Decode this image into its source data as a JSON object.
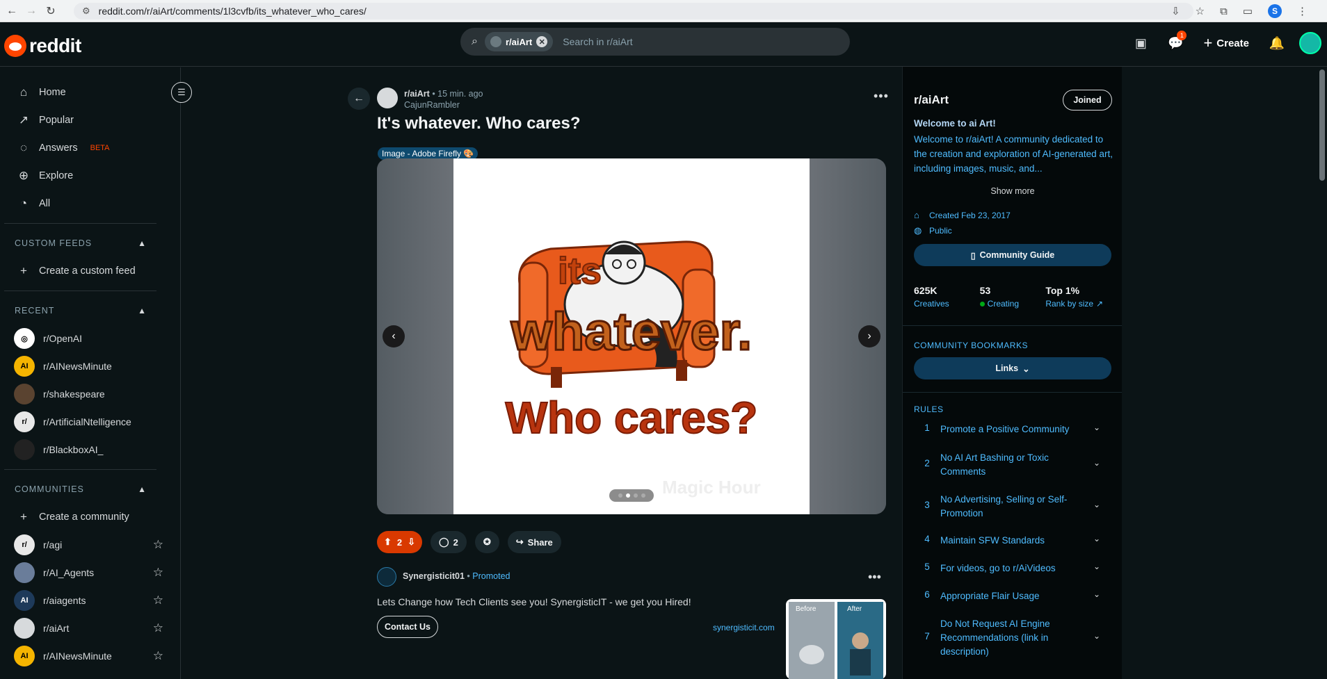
{
  "browser": {
    "url": "reddit.com/r/aiArt/comments/1l3cvfb/its_whatever_who_cares/",
    "profile_initial": "S"
  },
  "header": {
    "logo_text": "reddit",
    "search_chip": "r/aiArt",
    "search_placeholder": "Search in r/aiArt",
    "create_label": "Create",
    "chat_badge": "1"
  },
  "sidebar": {
    "nav": [
      {
        "label": "Home",
        "icon": "home-icon"
      },
      {
        "label": "Popular",
        "icon": "popular-icon"
      },
      {
        "label": "Answers",
        "badge": "BETA",
        "icon": "answers-icon"
      },
      {
        "label": "Explore",
        "icon": "explore-icon"
      },
      {
        "label": "All",
        "icon": "all-icon"
      }
    ],
    "custom_feeds_title": "CUSTOM FEEDS",
    "create_custom_feed": "Create a custom feed",
    "recent_title": "RECENT",
    "recent": [
      "r/OpenAI",
      "r/AINewsMinute",
      "r/shakespeare",
      "r/ArtificialNtelligence",
      "r/BlackboxAI_"
    ],
    "communities_title": "COMMUNITIES",
    "create_community": "Create a community",
    "communities": [
      "r/agi",
      "r/AI_Agents",
      "r/aiagents",
      "r/aiArt",
      "r/AINewsMinute"
    ]
  },
  "post": {
    "subreddit": "r/aiArt",
    "time": "15 min. ago",
    "author": "CajunRambler",
    "title": "It's whatever. Who cares?",
    "flair": "Image - Adobe Firefly 🎨",
    "image_text_top": "its",
    "image_text_mid": "whatever.",
    "image_text_bottom": "Who cares?",
    "watermark": "Magic Hour",
    "gallery_current": 2,
    "gallery_total": 4,
    "votes": "2",
    "comments": "2",
    "share_label": "Share"
  },
  "promo": {
    "advertiser": "Synergisticit01",
    "promoted_label": "Promoted",
    "text": "Lets Change how Tech Clients see you! SynergisticIT - we get you Hired!",
    "cta": "Contact Us",
    "domain": "synergisticit.com",
    "before_label": "Before",
    "after_label": "After"
  },
  "community": {
    "name": "r/aiArt",
    "joined_label": "Joined",
    "welcome": "Welcome to ai Art!",
    "description": "Welcome to r/aiArt! A community dedicated to the creation and exploration of AI-generated art, including images, music, and...",
    "show_more": "Show more",
    "created": "Created Feb 23, 2017",
    "visibility": "Public",
    "guide_label": "Community Guide",
    "members": "625K",
    "members_label": "Creatives",
    "online": "53",
    "online_label": "Creating",
    "rank": "Top 1%",
    "rank_label": "Rank by size",
    "bookmarks_title": "COMMUNITY BOOKMARKS",
    "links_label": "Links",
    "rules_title": "RULES",
    "rules": [
      "Promote a Positive Community",
      "No AI Art Bashing or Toxic Comments",
      "No Advertising, Selling or Self-Promotion",
      "Maintain SFW Standards",
      "For videos, go to r/AiVideos",
      "Appropriate Flair Usage",
      "Do Not Request AI Engine Recommendations (link in description)"
    ]
  },
  "colors": {
    "accent": "#ff4500",
    "link": "#4fbcff",
    "upvoted": "#d93900"
  }
}
